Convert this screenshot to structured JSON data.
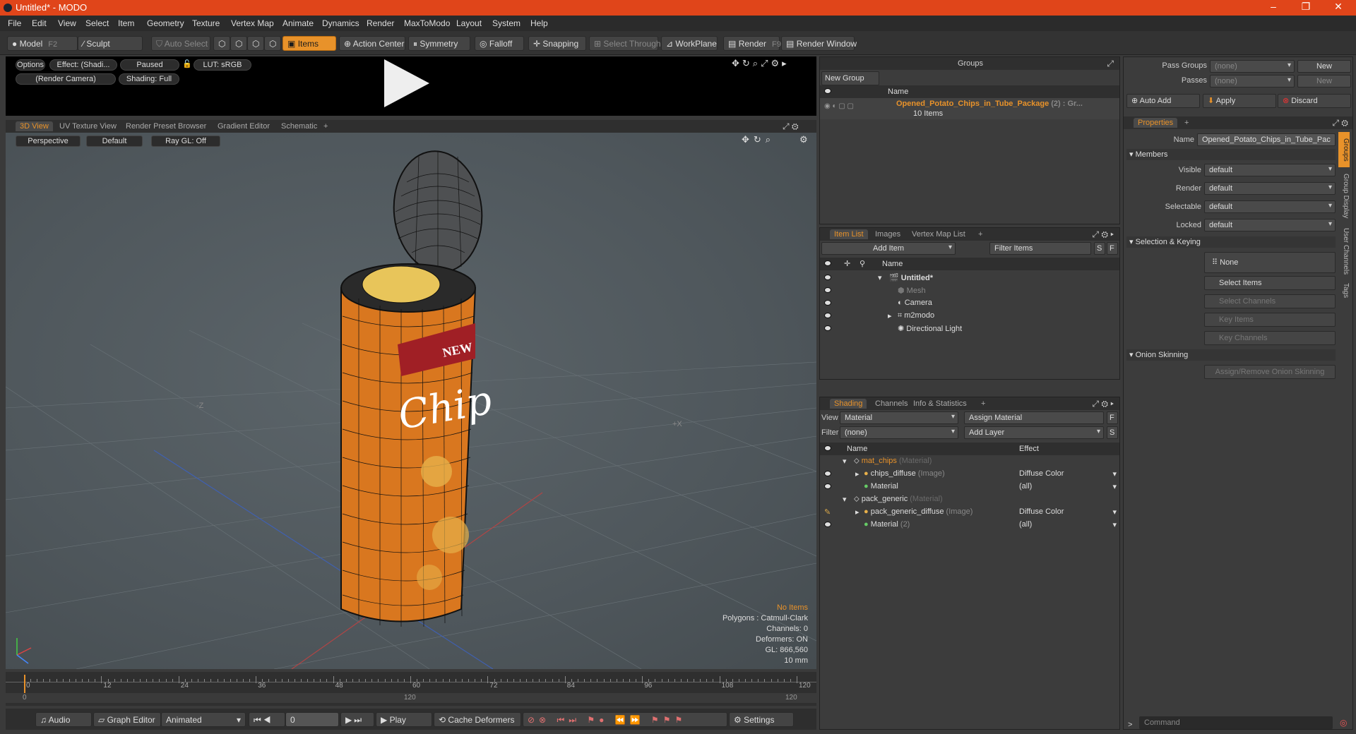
{
  "window": {
    "title": "Untitled* - MODO"
  },
  "menu": [
    "File",
    "Edit",
    "View",
    "Select",
    "Item",
    "Geometry",
    "Texture",
    "Vertex Map",
    "Animate",
    "Dynamics",
    "Render",
    "MaxToModo",
    "Layout",
    "System",
    "Help"
  ],
  "toolbar": {
    "model": "Model",
    "model_key": "F2",
    "sculpt": "Sculpt",
    "auto_select": "Auto Select",
    "items": "Items",
    "action_center": "Action Center",
    "symmetry": "Symmetry",
    "falloff": "Falloff",
    "snapping": "Snapping",
    "select_through": "Select Through",
    "workplane": "WorkPlane",
    "render": "Render",
    "render_key": "F9",
    "render_window": "Render Window"
  },
  "preview": {
    "options": "Options",
    "effect": "Effect: (Shadi...",
    "paused": "Paused",
    "lut": "LUT: sRGB",
    "camera": "(Render Camera)",
    "shading": "Shading: Full"
  },
  "viewport_tabs": [
    "3D View",
    "UV Texture View",
    "Render Preset Browser",
    "Gradient Editor",
    "Schematic"
  ],
  "viewport": {
    "perspective": "Perspective",
    "default": "Default",
    "raygl": "Ray GL: Off",
    "axis_neg_z": "-Z",
    "axis_pos_x": "+X",
    "label_new": "NEW",
    "label_chips": "Chip"
  },
  "stats": {
    "no_items": "No Items",
    "polygons": "Polygons : Catmull-Clark",
    "channels": "Channels: 0",
    "deformers": "Deformers: ON",
    "gl": "GL: 866,560",
    "scale": "10 mm"
  },
  "timeline": {
    "ticks": [
      "0",
      "12",
      "24",
      "36",
      "48",
      "60",
      "72",
      "84",
      "96",
      "108",
      "120"
    ],
    "range_start": "0",
    "range_mid": "120",
    "range_end": "120"
  },
  "bottombar": {
    "audio": "Audio",
    "graph_editor": "Graph Editor",
    "animated": "Animated",
    "frame": "0",
    "play": "Play",
    "cache_deformers": "Cache Deformers",
    "settings": "Settings"
  },
  "groups": {
    "title": "Groups",
    "new_group": "New Group",
    "col_name": "Name",
    "item_name": "Opened_Potato_Chips_in_Tube_Package",
    "item_suffix": "(2) : Gr...",
    "item_count": "10 Items"
  },
  "itemlist": {
    "tabs": [
      "Item List",
      "Images",
      "Vertex Map List"
    ],
    "add_item": "Add Item",
    "filter": "Filter Items",
    "btn_s": "S",
    "btn_f": "F",
    "col_name": "Name",
    "items": [
      {
        "name": "Untitled*"
      },
      {
        "name": "Mesh"
      },
      {
        "name": "Camera"
      },
      {
        "name": "m2modo"
      },
      {
        "name": "Directional Light"
      }
    ]
  },
  "shading": {
    "tabs": [
      "Shading",
      "Channels",
      "Info & Statistics"
    ],
    "view_label": "View",
    "view_value": "Material",
    "assign_material": "Assign Material",
    "filter_label": "Filter",
    "filter_value": "(none)",
    "add_layer": "Add Layer",
    "btn_f": "F",
    "btn_s": "S",
    "col_name": "Name",
    "col_effect": "Effect",
    "rows": [
      {
        "name": "mat_chips",
        "type": "(Material)",
        "effect": ""
      },
      {
        "name": "chips_diffuse",
        "type": "(Image)",
        "effect": "Diffuse Color"
      },
      {
        "name": "Material",
        "type": "",
        "effect": "(all)"
      },
      {
        "name": "pack_generic",
        "type": "(Material)",
        "effect": ""
      },
      {
        "name": "pack_generic_diffuse",
        "type": "(Image)",
        "effect": "Diffuse Color"
      },
      {
        "name": "Material",
        "type": "(2)",
        "effect": "(all)"
      }
    ]
  },
  "passes": {
    "pass_groups": "Pass Groups",
    "pass_groups_value": "(none)",
    "new": "New",
    "passes": "Passes",
    "passes_value": "(none)",
    "new2": "New"
  },
  "actions": {
    "auto_add": "Auto Add",
    "apply": "Apply",
    "discard": "Discard"
  },
  "properties": {
    "tab": "Properties",
    "name_label": "Name",
    "name_value": "Opened_Potato_Chips_in_Tube_Pac",
    "members": "Members",
    "visible_label": "Visible",
    "visible": "default",
    "render_label": "Render",
    "render": "default",
    "selectable_label": "Selectable",
    "selectable": "default",
    "locked_label": "Locked",
    "locked": "default",
    "sel_keying": "Selection & Keying",
    "none": "None",
    "select_items": "Select Items",
    "select_channels": "Select Channels",
    "key_items": "Key Items",
    "key_channels": "Key Channels",
    "onion": "Onion Skinning",
    "onion_btn": "Assign/Remove Onion Skinning"
  },
  "side_tabs": [
    "Groups",
    "Group Display",
    "User Channels",
    "Tags"
  ],
  "command": {
    "placeholder": "Command"
  }
}
